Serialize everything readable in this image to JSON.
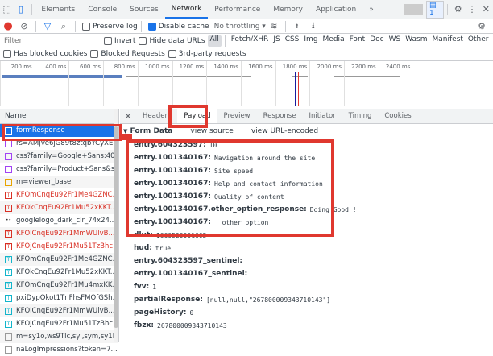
{
  "devtools_tabs": [
    "Elements",
    "Console",
    "Sources",
    "Network",
    "Performance",
    "Memory",
    "Application"
  ],
  "active_tab": "Network",
  "more_tabs": "»",
  "issues_count": "1",
  "toolbar": {
    "preserve_log": "Preserve log",
    "disable_cache": "Disable cache",
    "throttling": "No throttling"
  },
  "filter": {
    "placeholder": "Filter",
    "invert": "Invert",
    "hide_data_urls": "Hide data URLs",
    "types": [
      "All",
      "Fetch/XHR",
      "JS",
      "CSS",
      "Img",
      "Media",
      "Font",
      "Doc",
      "WS",
      "Wasm",
      "Manifest",
      "Other"
    ]
  },
  "options": {
    "blocked_cookies": "Has blocked cookies",
    "blocked_requests": "Blocked Requests",
    "third_party": "3rd-party requests"
  },
  "timeline_ticks": [
    "200 ms",
    "400 ms",
    "600 ms",
    "800 ms",
    "1000 ms",
    "1200 ms",
    "1400 ms",
    "1600 ms",
    "1800 ms",
    "2000 ms",
    "2200 ms",
    "2400 ms"
  ],
  "requests": {
    "header": "Name",
    "rows": [
      {
        "name": "formResponse",
        "type": "doc"
      },
      {
        "name": "rs=AMjVe6jG89t8ztqbYCyXE",
        "type": "css"
      },
      {
        "name": "css?family=Google+Sans:400",
        "type": "css"
      },
      {
        "name": "css?family=Product+Sans&s...",
        "type": "css"
      },
      {
        "name": "m=viewer_base",
        "type": "js"
      },
      {
        "name": "KFOmCnqEu92Fr1Me4GZNC...",
        "type": "font-err"
      },
      {
        "name": "KFOkCnqEu92Fr1Mu52xKKT...",
        "type": "font-err"
      },
      {
        "name": "googlelogo_dark_clr_74x24...",
        "type": "img"
      },
      {
        "name": "KFOlCnqEu92Fr1MmWUlvB...",
        "type": "font-err"
      },
      {
        "name": "KFOjCnqEu92Fr1Mu51TzBhc...",
        "type": "font-err"
      },
      {
        "name": "KFOmCnqEu92Fr1Me4GZNC...",
        "type": "font"
      },
      {
        "name": "KFOkCnqEu92Fr1Mu52xKKT...",
        "type": "font"
      },
      {
        "name": "KFOmCnqEu92Fr1Mu4mxKK...",
        "type": "font"
      },
      {
        "name": "pxiDypQkot1TnFhsFMOfGSh...",
        "type": "font"
      },
      {
        "name": "KFOlCnqEu92Fr1MmWUlvB...",
        "type": "font"
      },
      {
        "name": "KFOjCnqEu92Fr1Mu51TzBhc...",
        "type": "font"
      },
      {
        "name": "m=sy1o,ws9Tlc,syi,sym,sy1l,...",
        "type": "other"
      },
      {
        "name": "naLogImpressions?token=7...",
        "type": "other"
      }
    ]
  },
  "detail_tabs": [
    "Headers",
    "Payload",
    "Preview",
    "Response",
    "Initiator",
    "Timing",
    "Cookies"
  ],
  "active_detail_tab": "Payload",
  "form_data": {
    "title": "Form Data",
    "view_source": "view source",
    "view_url_encoded": "view URL-encoded",
    "entries": [
      {
        "key": "entry.604323597:",
        "value": "10"
      },
      {
        "key": "entry.1001340167:",
        "value": "Navigation around the site"
      },
      {
        "key": "entry.1001340167:",
        "value": "Site speed"
      },
      {
        "key": "entry.1001340167:",
        "value": "Help and contact information"
      },
      {
        "key": "entry.1001340167:",
        "value": "Quality of content"
      },
      {
        "key": "entry.1001340167.other_option_response:",
        "value": "Doing Good !"
      },
      {
        "key": "entry.1001340167:",
        "value": "__other_option__"
      },
      {
        "key": "dlut:",
        "value": "1660520001605"
      },
      {
        "key": "hud:",
        "value": "true"
      },
      {
        "key": "entry.604323597_sentinel:",
        "value": ""
      },
      {
        "key": "entry.1001340167_sentinel:",
        "value": ""
      },
      {
        "key": "fvv:",
        "value": "1"
      },
      {
        "key": "partialResponse:",
        "value": "[null,null,\"267800009343710143\"]"
      },
      {
        "key": "pageHistory:",
        "value": "0"
      },
      {
        "key": "fbzx:",
        "value": "267800009343710143"
      }
    ]
  },
  "colors": {
    "accent": "#1a73e8",
    "annotation": "#e0382f",
    "error": "#d93025"
  }
}
